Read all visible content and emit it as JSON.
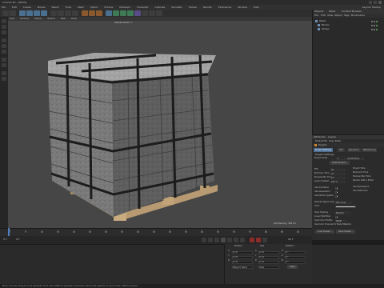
{
  "window": {
    "title": "Cinema 4D - [Pallet]"
  },
  "menu": {
    "items": [
      "File",
      "Edit",
      "Create",
      "Modes",
      "Select",
      "Tools",
      "Mesh",
      "Spline",
      "Volume",
      "MoGraph",
      "Character",
      "Animate",
      "Simulate",
      "Tracker",
      "Render",
      "Extensions",
      "Window",
      "Help"
    ],
    "right": "Layout:  Startup"
  },
  "viewport": {
    "menu": [
      "View",
      "Cameras",
      "Display",
      "Options",
      "Filter",
      "Panel"
    ],
    "camera": "Default Camera •°",
    "grid_spacing": "Grid Spacing : 500 cm"
  },
  "object_manager": {
    "tabs": [
      "Objects",
      "Takes",
      "Content Browser"
    ],
    "menu": [
      "File",
      "Edit",
      "View",
      "Object",
      "Tags",
      "Bookmarks"
    ],
    "objects": [
      {
        "name": "Pallet"
      },
      {
        "name": "Blocks"
      },
      {
        "name": "Straps"
      }
    ]
  },
  "attributes": {
    "tabs": [
      "Attributes",
      "Layers"
    ],
    "menu": [
      "Mode",
      "Edit",
      "User Data"
    ],
    "title": "Project",
    "subtabs": [
      "Project Settings",
      "Info",
      "Dynamics",
      "Referencing",
      "To Do"
    ],
    "section": "Project Settings",
    "scale_label": "Project Scale",
    "scale_value": "1",
    "scale_unit": "Centimeters",
    "scale_button": "Scale Project...",
    "fps_label": "FPS",
    "fps_value": "30",
    "project_time_label": "Project Time",
    "project_time_value": "0 F",
    "min_time_label": "Minimum Time",
    "min_time_value": "0 F",
    "max_time_label": "Maximum Time",
    "max_time_value": "90 F",
    "preview_min_label": "Preview Min Time",
    "preview_min_value": "0 F",
    "preview_max_label": "Preview Max Time",
    "preview_max_value": "90 F",
    "lod_label": "Level of Detail",
    "lod_value": "100 %",
    "render_lod_label": "Render LOD in Editor",
    "use_animation_label": "Use Animation",
    "use_expression_label": "Use Expressions",
    "use_generators_label": "Use Generators",
    "use_deformers_label": "Use Deformers",
    "use_motion_label": "Use Motion System",
    "default_color_label": "Default Object Color",
    "default_color_value": "80% Gray",
    "color_label": "Color",
    "view_clipping_label": "View Clipping",
    "view_clipping_value": "Medium",
    "linear_workflow_label": "Linear Workflow",
    "input_color_label": "Input Color Profile",
    "input_color_value": "sRGB",
    "use_color_channel_label": "Use Color Channel for Node Material",
    "load_button": "Load Preset...",
    "save_button": "Save Preset..."
  },
  "timeline": {
    "ticks": [
      "0",
      "5",
      "10",
      "15",
      "20",
      "25",
      "30",
      "35",
      "40",
      "45",
      "50",
      "55",
      "60",
      "65",
      "70",
      "75",
      "80",
      "85",
      "90"
    ],
    "start": "0 F",
    "end": "90 F",
    "current": "0 F"
  },
  "coordinates": {
    "headers": [
      "Position",
      "Size",
      "Rotation"
    ],
    "rows": [
      {
        "axis": "X",
        "pos": "0 cm",
        "size": "0 cm",
        "rot_axis": "H",
        "rot": "0 °"
      },
      {
        "axis": "Y",
        "pos": "0 cm",
        "size": "0 cm",
        "rot_axis": "P",
        "rot": "0 °"
      },
      {
        "axis": "Z",
        "pos": "0 cm",
        "size": "0 cm",
        "rot_axis": "B",
        "rot": "0 °"
      }
    ],
    "mode": "Object (Rel)",
    "size_mode": "Size",
    "apply": "Apply"
  },
  "status": {
    "text": "Move: Click and drag to move elements. Hold down SHIFT to quantize movement / add to the selection in point mode, CTRL to remove."
  },
  "colors": {
    "accent": "#4f6f94",
    "viewport_bg": "#464646",
    "panel_bg": "#2a2a2a"
  }
}
